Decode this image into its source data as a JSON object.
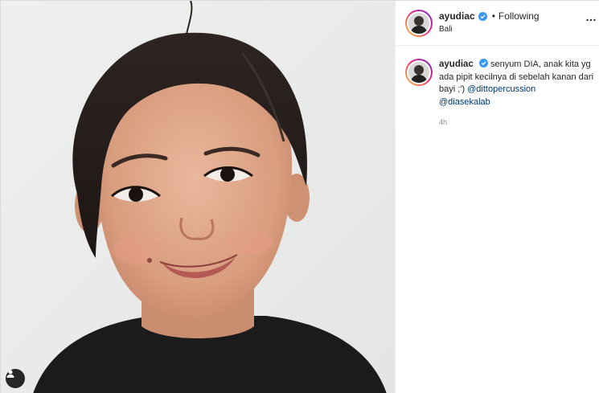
{
  "post": {
    "author": {
      "username": "ayudiac",
      "verified": true,
      "follow_status": "Following",
      "separator": "•",
      "location": "Bali"
    },
    "more_icon": "…",
    "caption": {
      "username": "ayudiac",
      "text": "senyum DIA, anak kita yg ada pipit kecilnya di sebelah kanan dari bayi ;')",
      "mentions": [
        "@dittopercussion",
        "@diasekalab"
      ],
      "timestamp": "4h"
    },
    "photo": {
      "tag_icon": "user-tag-icon"
    }
  },
  "colors": {
    "verified_blue": "#3897f0",
    "mention_blue": "#00376b",
    "muted_gray": "#8e8e8e",
    "story_ring": [
      "#f9ce34",
      "#ee2a7b",
      "#6228d7"
    ]
  }
}
